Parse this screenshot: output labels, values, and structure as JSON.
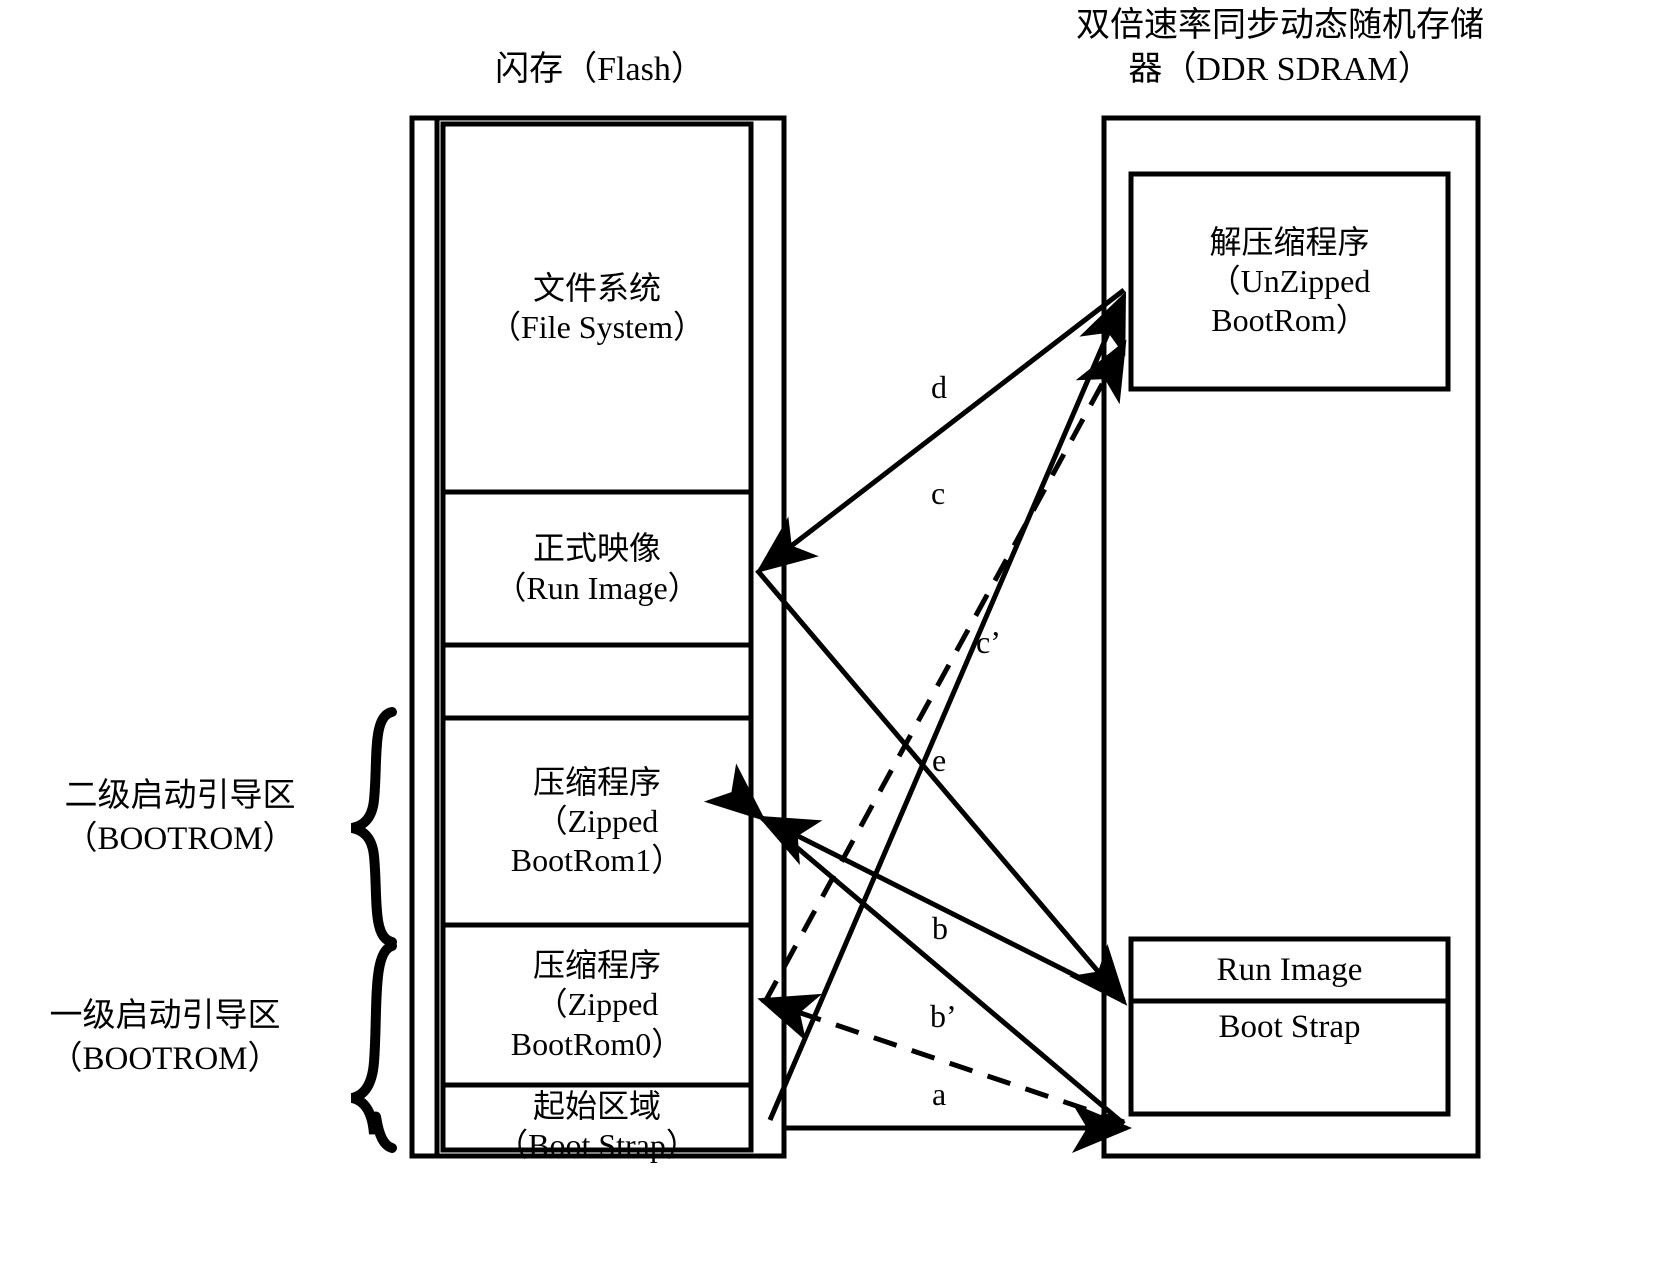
{
  "diagram": {
    "flash": {
      "title": "闪存（Flash）",
      "blocks": [
        {
          "id": "file-system",
          "label": "文件系统\n（File System）"
        },
        {
          "id": "run-image",
          "label": "正式映像\n（Run Image）"
        },
        {
          "id": "spacer",
          "label": ""
        },
        {
          "id": "zipped-bootrom1",
          "label": "压缩程序\n（Zipped\nBootRom1）"
        },
        {
          "id": "zipped-bootrom0",
          "label": "压缩程序\n（Zipped\nBootRom0）"
        },
        {
          "id": "boot-strap",
          "label": "起始区域\n（Boot Strap）"
        }
      ]
    },
    "ddr": {
      "title": "双倍速率同步动态随机存储\n器（DDR SDRAM）",
      "blocks": [
        {
          "id": "unzipped-bootrom",
          "label": "解压缩程序\n（UnZipped\nBootRom）"
        },
        {
          "id": "run-image",
          "label": "Run Image"
        },
        {
          "id": "boot-strap",
          "label": "Boot Strap"
        }
      ]
    },
    "brackets": [
      {
        "id": "secondary-bootrom",
        "label": "二级启动引导区\n（BOOTROM）"
      },
      {
        "id": "primary-bootrom",
        "label": "一级启动引导区\n（BOOTROM）"
      }
    ],
    "arrows": [
      {
        "id": "a",
        "label": "a",
        "style": "dashed"
      },
      {
        "id": "b",
        "label": "b",
        "style": "solid"
      },
      {
        "id": "bp",
        "label": "b’",
        "style": "solid"
      },
      {
        "id": "c",
        "label": "c",
        "style": "solid"
      },
      {
        "id": "cp",
        "label": "c’",
        "style": "dashed"
      },
      {
        "id": "d",
        "label": "d",
        "style": "solid"
      },
      {
        "id": "e",
        "label": "e",
        "style": "solid"
      }
    ],
    "colors": {
      "stroke": "#000000",
      "background": "#ffffff"
    }
  }
}
